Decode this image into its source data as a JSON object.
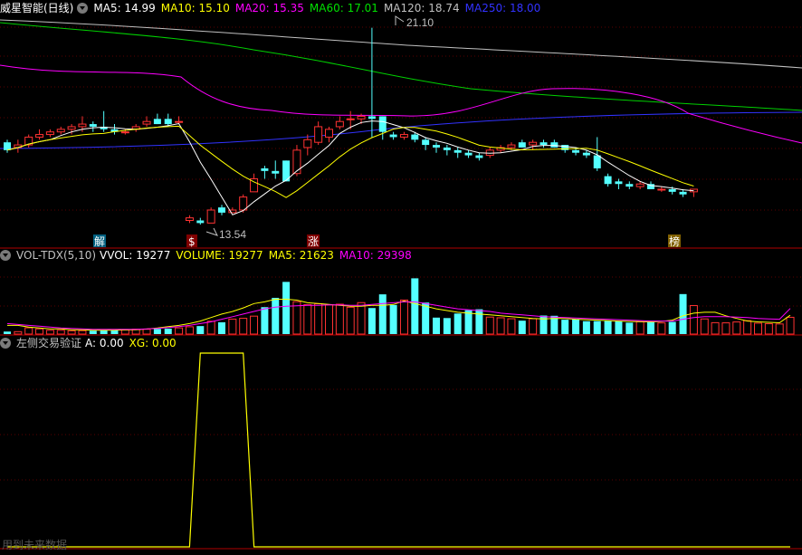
{
  "price_header": {
    "title": "威星智能(日线)",
    "ma5": "MA5: 14.99",
    "ma10": "MA10: 15.10",
    "ma20": "MA20: 15.35",
    "ma60": "MA60: 17.01",
    "ma120": "MA120: 18.74",
    "ma250": "MA250: 18.00"
  },
  "volume_header": {
    "title": "VOL-TDX(5,10)",
    "vvol": "VVOL: 19277",
    "volume": "VOLUME: 19277",
    "ma5": "MA5: 21623",
    "ma10": "MA10: 29398"
  },
  "indicator_header": {
    "title": "左侧交易验证",
    "a": "A: 0.00",
    "xg": "XG: 0.00"
  },
  "annotations": {
    "high": "21.10",
    "low": "13.54",
    "marker_jie": "解",
    "marker_dollar": "$",
    "marker_zhang": "涨",
    "marker_bang": "榜"
  },
  "footer_note": "用到未来数据",
  "colors": {
    "up": "#ff3232",
    "down": "#54ffff",
    "ma5": "#ffffff",
    "ma10": "#ffff00",
    "ma20": "#ff00ff",
    "ma60": "#00e000",
    "ma120": "#c0c0c0",
    "ma250": "#3232ff",
    "separator": "#b00000"
  },
  "chart_data": [
    {
      "type": "candlestick",
      "title": "威星智能(日线)",
      "ylim": [
        13.3,
        21.4
      ],
      "candles": [
        {
          "o": 16.7,
          "h": 16.8,
          "l": 16.3,
          "c": 16.4
        },
        {
          "o": 16.5,
          "h": 16.8,
          "l": 16.3,
          "c": 16.6
        },
        {
          "o": 16.6,
          "h": 17.0,
          "l": 16.5,
          "c": 16.9
        },
        {
          "o": 16.9,
          "h": 17.2,
          "l": 16.8,
          "c": 17.0
        },
        {
          "o": 17.0,
          "h": 17.2,
          "l": 16.9,
          "c": 17.1
        },
        {
          "o": 17.1,
          "h": 17.3,
          "l": 17.0,
          "c": 17.2
        },
        {
          "o": 17.2,
          "h": 17.4,
          "l": 17.0,
          "c": 17.3
        },
        {
          "o": 17.3,
          "h": 17.7,
          "l": 17.1,
          "c": 17.4
        },
        {
          "o": 17.4,
          "h": 17.5,
          "l": 17.1,
          "c": 17.3
        },
        {
          "o": 17.3,
          "h": 17.9,
          "l": 17.1,
          "c": 17.2
        },
        {
          "o": 17.2,
          "h": 17.4,
          "l": 17.0,
          "c": 17.1
        },
        {
          "o": 17.1,
          "h": 17.2,
          "l": 17.0,
          "c": 17.1
        },
        {
          "o": 17.2,
          "h": 17.4,
          "l": 17.1,
          "c": 17.3
        },
        {
          "o": 17.4,
          "h": 17.7,
          "l": 17.3,
          "c": 17.5
        },
        {
          "o": 17.6,
          "h": 17.8,
          "l": 17.4,
          "c": 17.4
        },
        {
          "o": 17.6,
          "h": 17.8,
          "l": 17.3,
          "c": 17.4
        },
        {
          "o": 17.5,
          "h": 17.7,
          "l": 17.4,
          "c": 17.5
        },
        {
          "o": 13.7,
          "h": 13.9,
          "l": 13.6,
          "c": 13.8
        },
        {
          "o": 13.7,
          "h": 13.8,
          "l": 13.54,
          "c": 13.6
        },
        {
          "o": 13.6,
          "h": 14.2,
          "l": 13.6,
          "c": 14.1
        },
        {
          "o": 14.2,
          "h": 14.3,
          "l": 13.9,
          "c": 14.0
        },
        {
          "o": 14.0,
          "h": 14.2,
          "l": 14.0,
          "c": 14.1
        },
        {
          "o": 14.1,
          "h": 14.7,
          "l": 14.0,
          "c": 14.6
        },
        {
          "o": 14.8,
          "h": 15.5,
          "l": 14.8,
          "c": 15.3
        },
        {
          "o": 15.7,
          "h": 15.8,
          "l": 15.3,
          "c": 15.6
        },
        {
          "o": 15.6,
          "h": 16.0,
          "l": 15.3,
          "c": 15.5
        },
        {
          "o": 16.0,
          "h": 16.0,
          "l": 15.2,
          "c": 15.2
        },
        {
          "o": 15.5,
          "h": 16.6,
          "l": 15.4,
          "c": 16.4
        },
        {
          "o": 16.5,
          "h": 17.0,
          "l": 16.2,
          "c": 16.8
        },
        {
          "o": 16.7,
          "h": 17.5,
          "l": 16.6,
          "c": 17.3
        },
        {
          "o": 16.9,
          "h": 17.3,
          "l": 16.7,
          "c": 17.2
        },
        {
          "o": 17.3,
          "h": 17.7,
          "l": 17.2,
          "c": 17.5
        },
        {
          "o": 17.6,
          "h": 17.9,
          "l": 17.2,
          "c": 17.6
        },
        {
          "o": 17.6,
          "h": 17.8,
          "l": 17.4,
          "c": 17.7
        },
        {
          "o": 17.7,
          "h": 21.1,
          "l": 16.9,
          "c": 17.6
        },
        {
          "o": 17.7,
          "h": 17.7,
          "l": 16.8,
          "c": 17.1
        },
        {
          "o": 17.0,
          "h": 17.1,
          "l": 16.8,
          "c": 16.9
        },
        {
          "o": 16.9,
          "h": 17.1,
          "l": 16.8,
          "c": 17.0
        },
        {
          "o": 17.0,
          "h": 17.1,
          "l": 16.7,
          "c": 16.8
        },
        {
          "o": 16.8,
          "h": 16.9,
          "l": 16.4,
          "c": 16.6
        },
        {
          "o": 16.6,
          "h": 16.7,
          "l": 16.3,
          "c": 16.5
        },
        {
          "o": 16.5,
          "h": 16.6,
          "l": 16.2,
          "c": 16.4
        },
        {
          "o": 16.4,
          "h": 16.5,
          "l": 16.1,
          "c": 16.3
        },
        {
          "o": 16.3,
          "h": 16.4,
          "l": 16.1,
          "c": 16.2
        },
        {
          "o": 16.2,
          "h": 16.3,
          "l": 16.0,
          "c": 16.1
        },
        {
          "o": 16.2,
          "h": 16.5,
          "l": 16.1,
          "c": 16.4
        },
        {
          "o": 16.4,
          "h": 16.6,
          "l": 16.3,
          "c": 16.5
        },
        {
          "o": 16.5,
          "h": 16.7,
          "l": 16.4,
          "c": 16.6
        },
        {
          "o": 16.7,
          "h": 16.8,
          "l": 16.5,
          "c": 16.5
        },
        {
          "o": 16.6,
          "h": 16.8,
          "l": 16.4,
          "c": 16.7
        },
        {
          "o": 16.7,
          "h": 16.8,
          "l": 16.5,
          "c": 16.6
        },
        {
          "o": 16.7,
          "h": 16.8,
          "l": 16.5,
          "c": 16.5
        },
        {
          "o": 16.6,
          "h": 16.6,
          "l": 16.3,
          "c": 16.4
        },
        {
          "o": 16.4,
          "h": 16.5,
          "l": 16.2,
          "c": 16.3
        },
        {
          "o": 16.3,
          "h": 16.4,
          "l": 16.1,
          "c": 16.2
        },
        {
          "o": 16.2,
          "h": 16.9,
          "l": 15.6,
          "c": 15.7
        },
        {
          "o": 15.4,
          "h": 15.5,
          "l": 15.0,
          "c": 15.1
        },
        {
          "o": 15.2,
          "h": 15.3,
          "l": 14.9,
          "c": 15.1
        },
        {
          "o": 15.1,
          "h": 15.2,
          "l": 14.9,
          "c": 15.0
        },
        {
          "o": 15.0,
          "h": 15.2,
          "l": 14.9,
          "c": 15.1
        },
        {
          "o": 15.1,
          "h": 15.2,
          "l": 14.9,
          "c": 14.9
        },
        {
          "o": 14.9,
          "h": 15.0,
          "l": 14.8,
          "c": 14.9
        },
        {
          "o": 14.9,
          "h": 15.0,
          "l": 14.7,
          "c": 14.8
        },
        {
          "o": 14.8,
          "h": 14.9,
          "l": 14.6,
          "c": 14.7
        },
        {
          "o": 14.8,
          "h": 14.9,
          "l": 14.6,
          "c": 14.9
        }
      ]
    },
    {
      "type": "bar",
      "title": "VOL-TDX(5,10)",
      "ylim": [
        0,
        80000
      ],
      "values": [
        2900,
        2800,
        7200,
        6000,
        4400,
        4400,
        3800,
        3900,
        3900,
        4300,
        4400,
        4800,
        5700,
        5500,
        6000,
        6300,
        7100,
        8400,
        9200,
        14700,
        13500,
        17200,
        18100,
        20600,
        30900,
        41600,
        59900,
        37200,
        33700,
        34800,
        33500,
        34300,
        30800,
        36100,
        29900,
        45600,
        33400,
        39100,
        64000,
        36200,
        18900,
        18400,
        23600,
        27400,
        28500,
        19500,
        18700,
        17600,
        15400,
        17600,
        21300,
        21000,
        16500,
        17200,
        14800,
        14900,
        15000,
        14500,
        13100,
        14200,
        13500,
        12800,
        14000,
        45900,
        32700,
        17400,
        13100,
        12900,
        13900,
        15400,
        12500,
        11900,
        11600,
        19277
      ],
      "ma5": [
        10000,
        10000,
        8000,
        7000,
        6000,
        6000,
        5000,
        5000,
        4500,
        4500,
        4500,
        4800,
        5000,
        5800,
        7000,
        8500,
        10000,
        12000,
        15000,
        19000,
        23000,
        26000,
        30000,
        35000,
        37000,
        40000,
        40000,
        39000,
        36000,
        35000,
        34000,
        33000,
        32000,
        32000,
        33000,
        33000,
        34000,
        38000,
        35000,
        32000,
        29000,
        27000,
        25000,
        24000,
        23000,
        22000,
        21000,
        20000,
        19000,
        18000,
        17500,
        18000,
        18000,
        17000,
        16500,
        16000,
        15500,
        15000,
        14500,
        14200,
        14000,
        14500,
        16000,
        21000,
        24000,
        25000,
        25000,
        21000,
        18000,
        15000,
        14000,
        13500,
        13000,
        21623
      ],
      "ma10": [
        12000,
        11000,
        10000,
        9000,
        8000,
        7000,
        6500,
        6000,
        5500,
        5500,
        5500,
        5500,
        5500,
        6000,
        6500,
        7500,
        8500,
        10000,
        12000,
        14000,
        17000,
        20000,
        23000,
        26000,
        29000,
        31000,
        32000,
        32500,
        33000,
        33000,
        33500,
        33500,
        33000,
        33000,
        34000,
        35000,
        36000,
        37000,
        37000,
        35000,
        33000,
        31000,
        29000,
        28000,
        27000,
        26000,
        24000,
        23000,
        22000,
        21000,
        20000,
        19500,
        19000,
        18500,
        18000,
        17500,
        17000,
        16500,
        16000,
        15500,
        15000,
        15000,
        15000,
        17000,
        19000,
        20000,
        20000,
        20000,
        19500,
        19000,
        18000,
        17500,
        17000,
        29398
      ]
    },
    {
      "type": "line",
      "title": "左侧交易验证",
      "ylim": [
        0,
        1
      ],
      "values": [
        0,
        0,
        0,
        0,
        0,
        0,
        0,
        0,
        0,
        0,
        0,
        0,
        0,
        0,
        0,
        0,
        0,
        0,
        1,
        1,
        1,
        1,
        1,
        0,
        0,
        0,
        0,
        0,
        0,
        0,
        0,
        0,
        0,
        0,
        0,
        0,
        0,
        0,
        0,
        0,
        0,
        0,
        0,
        0,
        0,
        0,
        0,
        0,
        0,
        0,
        0,
        0,
        0,
        0,
        0,
        0,
        0,
        0,
        0,
        0,
        0,
        0,
        0,
        0,
        0,
        0,
        0,
        0,
        0,
        0,
        0,
        0,
        0,
        0
      ]
    }
  ]
}
